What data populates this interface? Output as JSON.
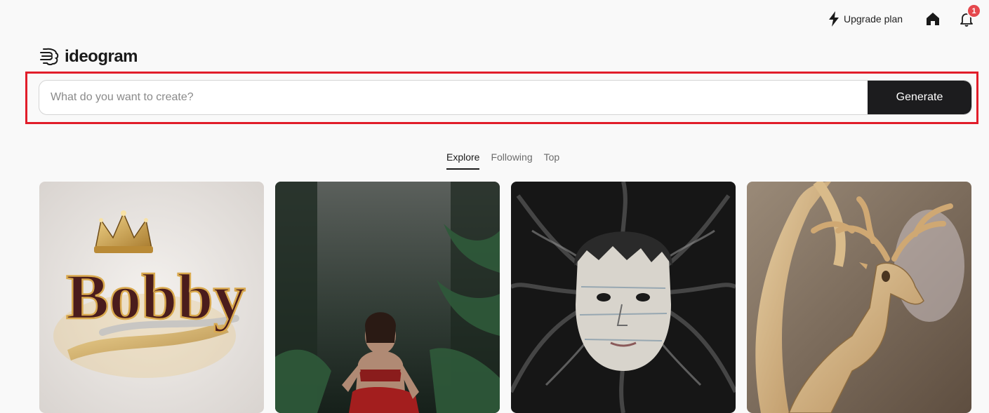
{
  "header": {
    "upgrade_label": "Upgrade plan",
    "notification_count": "1"
  },
  "logo": {
    "text": "ideogram"
  },
  "prompt": {
    "placeholder": "What do you want to create?",
    "generate_label": "Generate"
  },
  "tabs": [
    {
      "label": "Explore",
      "active": true
    },
    {
      "label": "Following",
      "active": false
    },
    {
      "label": "Top",
      "active": false
    }
  ],
  "gallery": {
    "cards": [
      {
        "text": "Bobby"
      }
    ]
  },
  "colors": {
    "background": "#f9f9f9",
    "generate_bg": "#1c1c1e",
    "badge": "#e5484d",
    "highlight_border": "#e11d2a"
  }
}
